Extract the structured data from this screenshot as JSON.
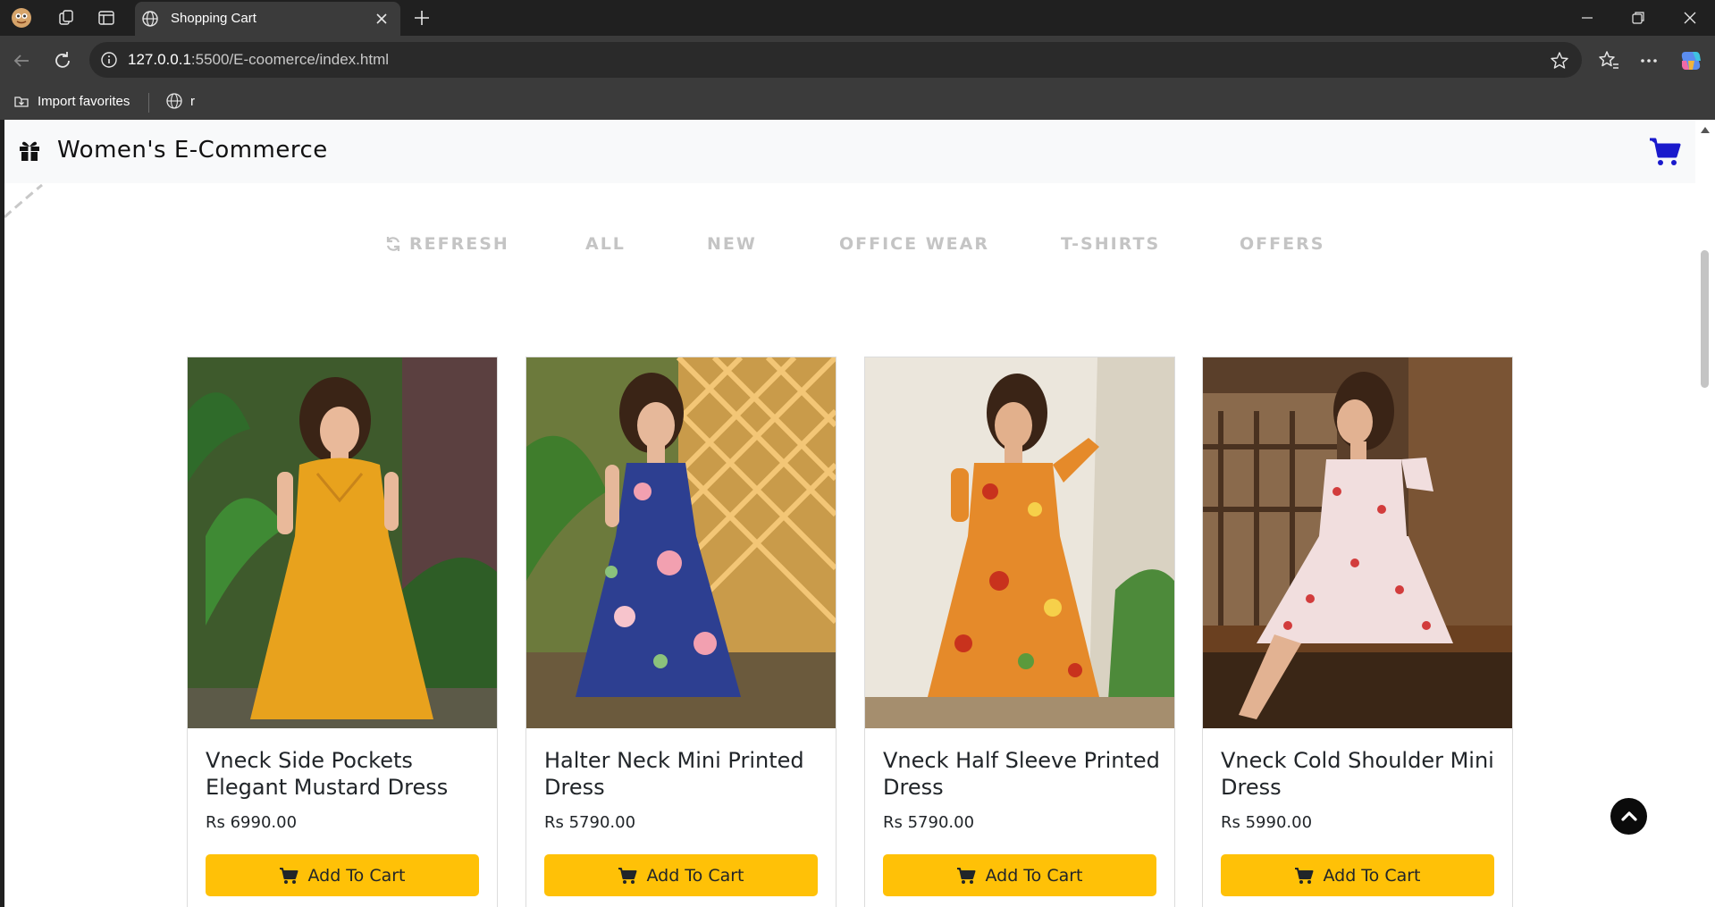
{
  "browser": {
    "tab_title": "Shopping Cart",
    "url_host": "127.0.0.1",
    "url_rest": ":5500/E-coomerce/index.html",
    "favorites": [
      {
        "label": "Import favorites",
        "icon": "import-icon"
      },
      {
        "label": "r",
        "icon": "globe-icon"
      }
    ]
  },
  "site": {
    "brand": "Women's E-Commerce",
    "filters": [
      "REFRESH",
      "ALL",
      "NEW",
      "OFFICE WEAR",
      "T-SHIRTS",
      "OFFERS"
    ],
    "products": [
      {
        "title": "Vneck Side Pockets Elegant Mustard Dress",
        "price": "Rs 6990.00",
        "button": "Add To Cart",
        "dress_color": "#e8a21d"
      },
      {
        "title": "Halter Neck Mini Printed Dress",
        "price": "Rs 5790.00",
        "button": "Add To Cart",
        "dress_color": "#2d3f91"
      },
      {
        "title": "Vneck Half Sleeve Printed Dress",
        "price": "Rs 5790.00",
        "button": "Add To Cart",
        "dress_color": "#e58a2a"
      },
      {
        "title": "Vneck Cold Shoulder Mini Dress",
        "price": "Rs 5990.00",
        "button": "Add To Cart",
        "dress_color": "#f1dede"
      }
    ]
  },
  "colors": {
    "accent": "#ffc107",
    "cart_icon": "#1a1acc",
    "filter_text": "#c4c4c4"
  }
}
